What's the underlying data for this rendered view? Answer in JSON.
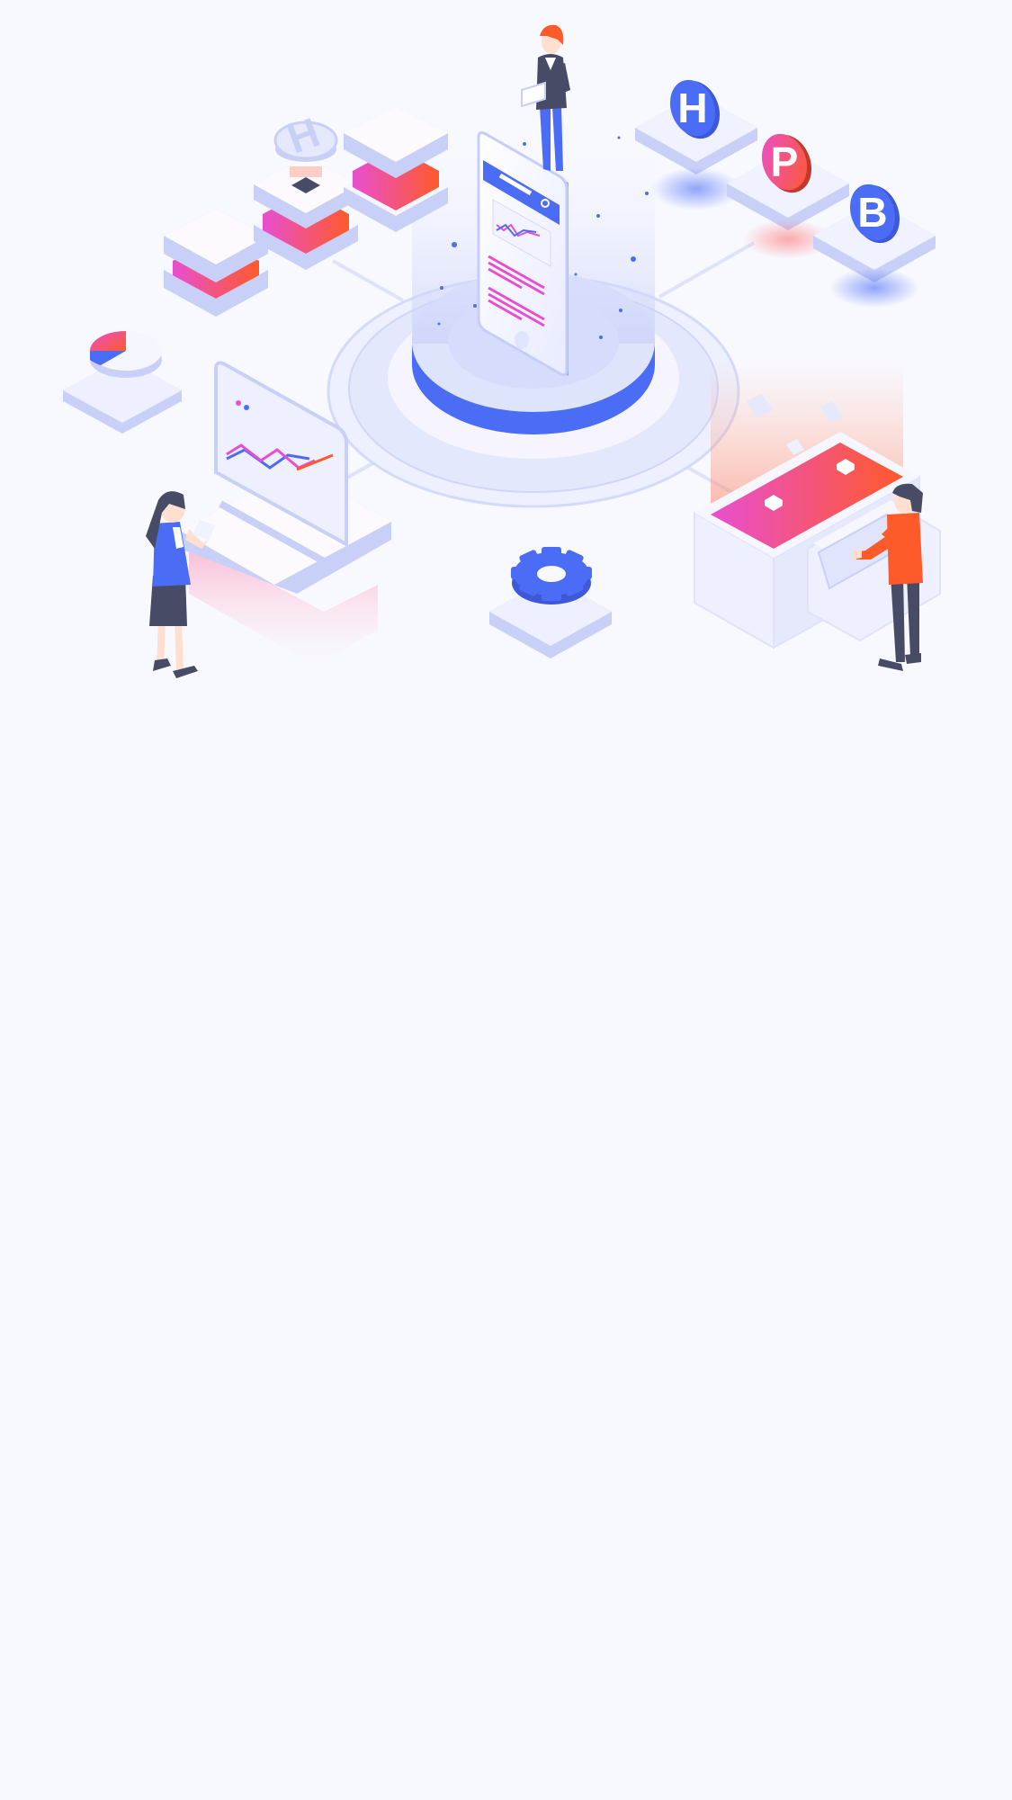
{
  "coins": [
    {
      "letter": "H"
    },
    {
      "letter": "P"
    },
    {
      "letter": "B"
    }
  ],
  "small_coin": {
    "letter": "H"
  },
  "colors": {
    "background": "#f8f9ff",
    "primary_blue": "#4b6cf5",
    "light_blue": "#c9d0f7",
    "pale_blue": "#e6e9fc",
    "platform_white": "#fdfaff",
    "magenta": "#e84fd0",
    "orange": "#ff5a2a",
    "dark": "#474b66"
  }
}
